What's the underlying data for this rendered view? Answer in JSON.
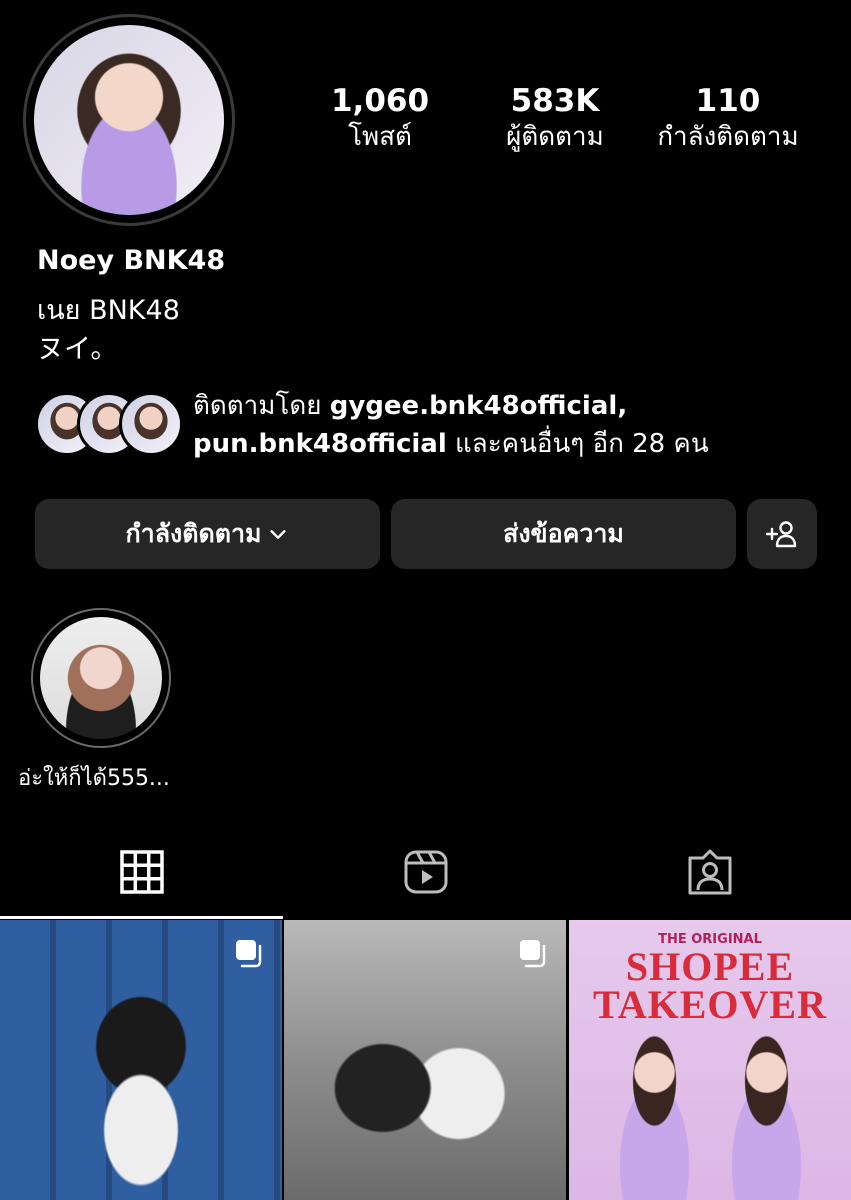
{
  "profile": {
    "display_name": "Noey BNK48",
    "bio_line1": "เนย BNK48",
    "bio_line2": "ヌイ。"
  },
  "stats": {
    "posts_count": "1,060",
    "posts_label": "โพสต์",
    "followers_count": "583K",
    "followers_label": "ผู้ติดตาม",
    "following_count": "110",
    "following_label": "กำลังติดตาม"
  },
  "followed_by": {
    "prefix": "ติดตามโดย ",
    "user1": "gygee.bnk48official",
    "separator": ",",
    "user2": "pun.bnk48official",
    "suffix": " และคนอื่นๆ อีก 28 คน"
  },
  "actions": {
    "following_button": "กำลังติดตาม",
    "message_button": "ส่งข้อความ",
    "add_user_icon": "add-person-icon"
  },
  "highlights": [
    {
      "label": "อ่ะให้ก็ได้555..."
    }
  ],
  "tabs": [
    {
      "icon": "grid-icon",
      "active": true
    },
    {
      "icon": "reels-icon",
      "active": false
    },
    {
      "icon": "tagged-icon",
      "active": false
    }
  ],
  "grid": {
    "tile3_small_text": "THE ORIGINAL",
    "tile3_big_text_1": "SHOPEE",
    "tile3_big_text_2": "TAKEOVER"
  },
  "colors": {
    "background": "#000000",
    "button_bg": "#262626",
    "text": "#ffffff"
  }
}
